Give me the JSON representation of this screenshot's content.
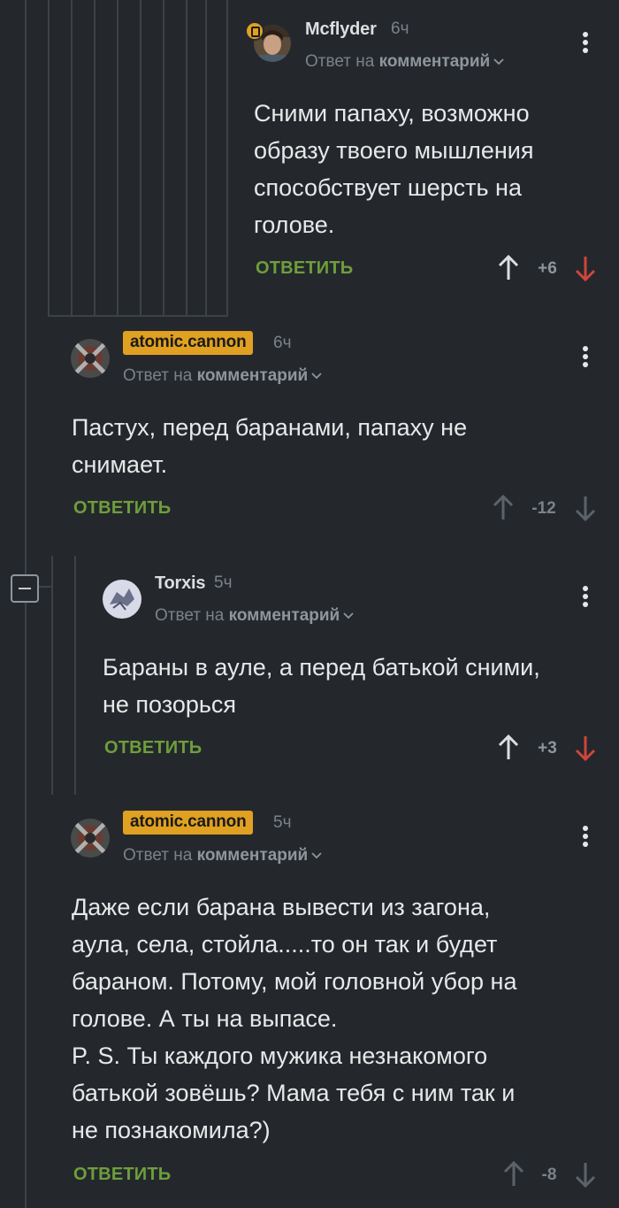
{
  "comments": [
    {
      "author": "Mcflyder",
      "time": "6ч",
      "reply_prefix": "Ответ на",
      "reply_target": "комментарий",
      "text": "Сними папаху, возможно\nобразу твоего мышления\nспособствует шерсть на\nголове.",
      "reply_label": "ОТВЕТИТЬ",
      "rating": "+6"
    },
    {
      "author": "atomic.cannon",
      "time": "6ч",
      "reply_prefix": "Ответ на",
      "reply_target": "комментарий",
      "text": "Пастух, перед баранами, папаху не\nснимает.",
      "reply_label": "ОТВЕТИТЬ",
      "rating": "-12"
    },
    {
      "author": "Torxis",
      "time": "5ч",
      "reply_prefix": "Ответ на",
      "reply_target": "комментарий",
      "text": "Бараны в ауле, а перед батькой сними,\nне позорься",
      "reply_label": "ОТВЕТИТЬ",
      "rating": "+3"
    },
    {
      "author": "atomic.cannon",
      "time": "5ч",
      "reply_prefix": "Ответ на",
      "reply_target": "комментарий",
      "text": "Даже если барана вывести из загона,\nаула, села, стойла.....то он так и будет\nбараном. Потому, мой головной убор на\nголове. А ты на выпасе.\n P. S. Ты каждого мужика незнакомого\nбатькой зовёшь? Мама тебя с ним так и\nне познакомила?)",
      "reply_label": "ОТВЕТИТЬ",
      "rating": "-8"
    }
  ],
  "colors": {
    "background": "#24282c",
    "thread_line": "#3d4246",
    "reply_green": "#6e9e3c",
    "badge_yellow": "#e0a021",
    "upvote_active": "#dcdedf",
    "downvote_red": "#d0453c",
    "vote_inactive": "#5c6368"
  },
  "icons": [
    "chevron-down-icon",
    "more-vert-icon",
    "arrow-up-icon",
    "arrow-down-icon",
    "collapse-minus-icon",
    "pro-badge-icon"
  ]
}
